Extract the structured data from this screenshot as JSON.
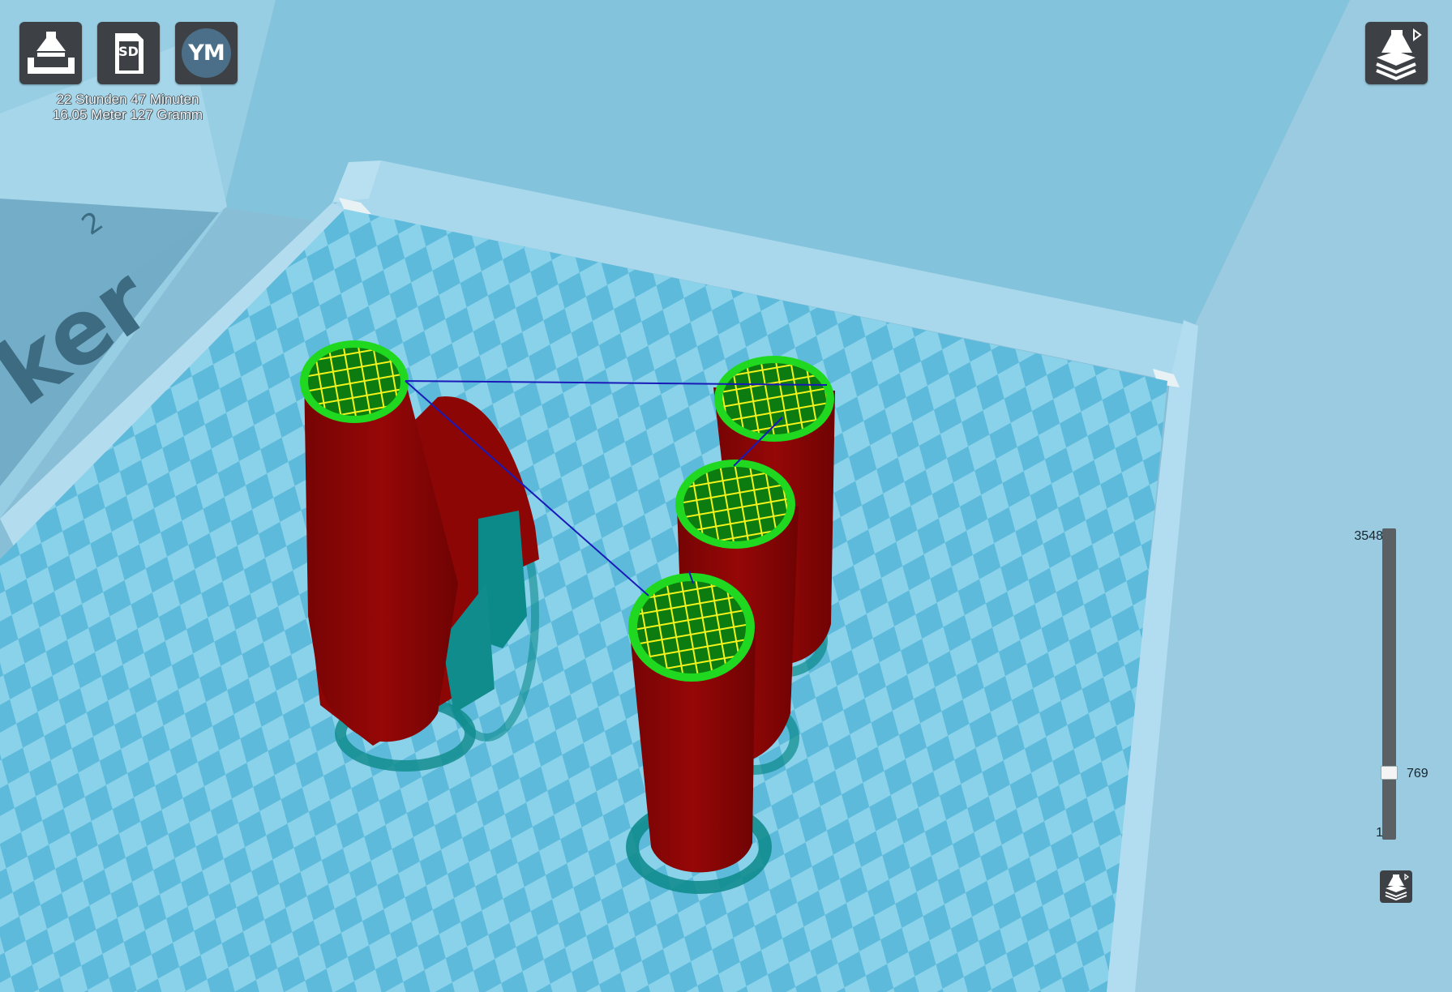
{
  "window": {
    "title": "Cura 3D printing slicer - layer view"
  },
  "toolbar": {
    "load_button": {
      "icon": "load-model-icon"
    },
    "sd_button": {
      "icon": "sd-card-icon",
      "label": "SD"
    },
    "ym_button": {
      "icon": "ym-avatar-icon",
      "label": "YM"
    },
    "view_mode_button": {
      "icon": "layer-view-icon"
    }
  },
  "print_info": {
    "time": "22 Stunden 47 Minuten",
    "material": "16.05 Meter 127 Gramm"
  },
  "printer": {
    "brand_text": "ker",
    "brand_superscript": "2"
  },
  "layer_slider": {
    "max_layer": "3548",
    "current_layer": "769",
    "min_layer": "1",
    "current_fraction": 0.216
  },
  "colors": {
    "background": "#88bfd6",
    "checker_light": "#8ad2ea",
    "checker_dark": "#5ebadb",
    "wall_red": "#8c0606",
    "skin_green": "#1fd81f",
    "infill_yellow": "#f3f31b",
    "support_teal": "#0c8a8a",
    "travel_blue": "#1a1ab8",
    "button_dark": "#3d4145"
  }
}
